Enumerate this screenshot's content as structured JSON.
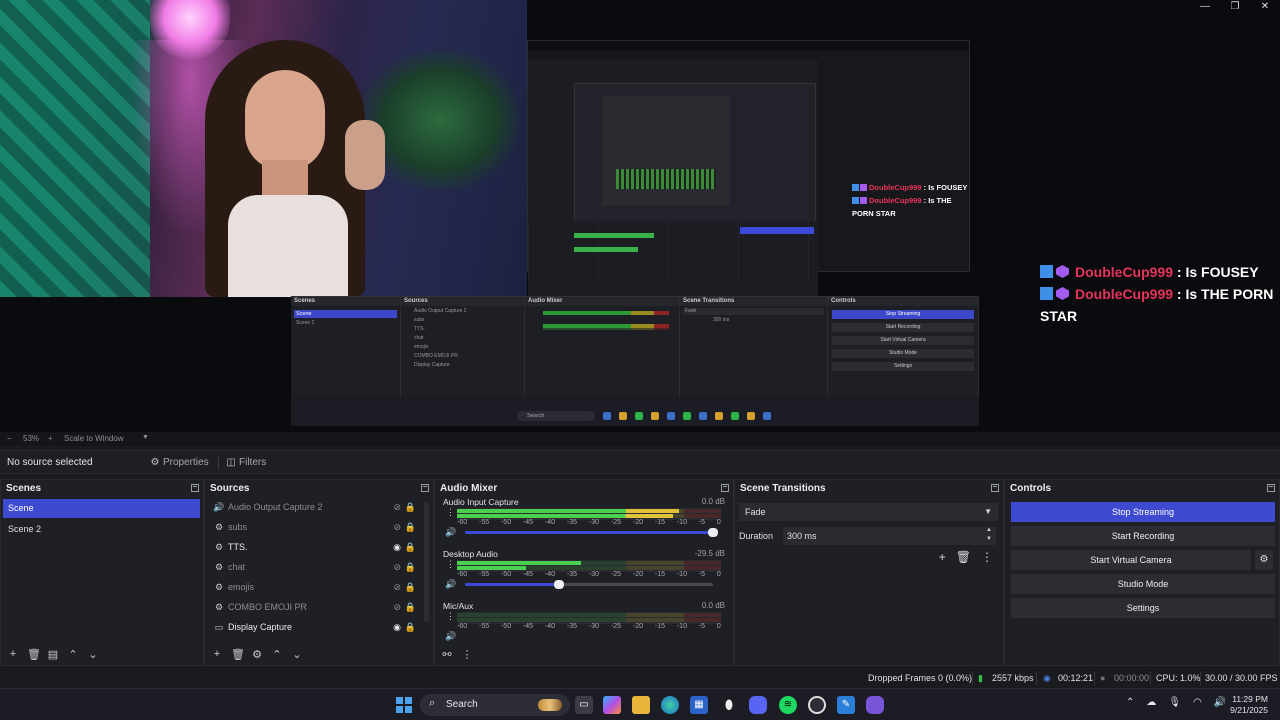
{
  "window": {
    "controls": [
      "—",
      "❐",
      "✕"
    ]
  },
  "preview": {
    "nested_chat": [
      {
        "user": "DoubleCup999",
        "message": ": Is FOUSEY"
      },
      {
        "user": "DoubleCup999",
        "message": ": Is THE PORN STAR"
      }
    ],
    "chat": [
      {
        "user": "DoubleCup999",
        "message": ": Is FOUSEY"
      },
      {
        "user": "DoubleCup999",
        "message": ": Is THE PORN STAR"
      }
    ],
    "mini_obs": {
      "scenes_title": "Scenes",
      "sources_title": "Sources",
      "mixer_title": "Audio Mixer",
      "transitions_title": "Scene Transitions",
      "controls_title": "Controls",
      "scenes": [
        "Scene",
        "Scene 2"
      ],
      "sources": [
        "Audio Output Capture 2",
        "subs",
        "TTS.",
        "chat",
        "emojis",
        "COMBO EMOJI PR",
        "Display Capture"
      ],
      "transition": "Fade",
      "duration": "300 ms",
      "buttons": [
        "Stop Streaming",
        "Start Recording",
        "Start Virtual Camera",
        "Studio Mode",
        "Settings"
      ],
      "search": "Search"
    }
  },
  "zoombar": {
    "minus": "−",
    "zoom": "53%",
    "plus": "+",
    "scale": "Scale to Window",
    "arrow": "▼"
  },
  "sourcebar": {
    "no_source": "No source selected",
    "properties": "Properties",
    "filters": "Filters"
  },
  "scenes": {
    "title": "Scenes",
    "items": [
      {
        "label": "Scene",
        "active": true
      },
      {
        "label": "Scene 2",
        "active": false
      }
    ]
  },
  "sources": {
    "title": "Sources",
    "items": [
      {
        "label": "Audio Output Capture 2",
        "icon": "speaker-icon",
        "visible": false
      },
      {
        "label": "subs",
        "icon": "gear-icon",
        "visible": false
      },
      {
        "label": "TTS.",
        "icon": "gear-icon",
        "visible": true
      },
      {
        "label": "chat",
        "icon": "gear-icon",
        "visible": false
      },
      {
        "label": "emojis",
        "icon": "gear-icon",
        "visible": false
      },
      {
        "label": "COMBO EMOJI PR",
        "icon": "gear-icon",
        "visible": false
      },
      {
        "label": "Display Capture",
        "icon": "monitor-icon",
        "visible": true
      }
    ]
  },
  "mixer": {
    "title": "Audio Mixer",
    "ticks": [
      "-60",
      "-55",
      "-50",
      "-45",
      "-40",
      "-35",
      "-30",
      "-25",
      "-20",
      "-15",
      "-10",
      "-5",
      "0"
    ],
    "channels": [
      {
        "name": "Audio Input Capture",
        "db": "0.0 dB",
        "level1": 0.84,
        "level2": 0.82,
        "volume": 1.0
      },
      {
        "name": "Desktop Audio",
        "db": "-29.5 dB",
        "level1": 0.47,
        "level2": 0.26,
        "volume": 0.38
      },
      {
        "name": "Mic/Aux",
        "db": "0.0 dB",
        "level1": 0.0,
        "level2": 0.0,
        "volume": 1.0
      }
    ]
  },
  "transitions": {
    "title": "Scene Transitions",
    "selected": "Fade",
    "duration_label": "Duration",
    "duration_value": "300 ms"
  },
  "controls": {
    "title": "Controls",
    "stop_streaming": "Stop Streaming",
    "start_recording": "Start Recording",
    "start_virtual_camera": "Start Virtual Camera",
    "studio_mode": "Studio Mode",
    "settings": "Settings"
  },
  "status": {
    "dropped_frames": "Dropped Frames 0 (0.0%)",
    "bitrate": "2557 kbps",
    "stream_time": "00:12:21",
    "record_time": "00:00:00",
    "cpu": "CPU: 1.0%",
    "fps": "30.00 / 30.00 FPS"
  },
  "taskbar": {
    "search": "Search",
    "time": "11:29 PM",
    "date": "9/21/2025"
  },
  "colors": {
    "accent": "#3e4bd1",
    "chat_user": "#e8345b",
    "meter_green": "#4ad04f"
  }
}
